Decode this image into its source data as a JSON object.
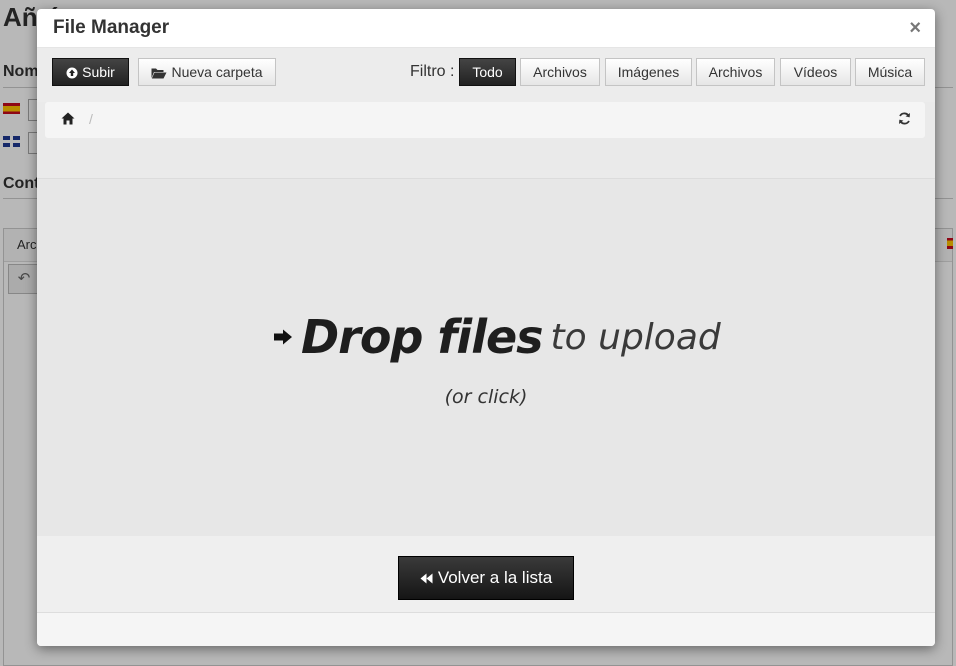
{
  "background": {
    "title": "Añ      ó",
    "label_nombre": "Nom",
    "label_contenido": "Cont",
    "panel_label": "Arc"
  },
  "modal": {
    "title": "File Manager",
    "close_symbol": "×"
  },
  "toolbar": {
    "upload_label": "Subir",
    "new_folder_label": "Nueva carpeta",
    "filter_label": "Filtro :",
    "filters": [
      "Todo",
      "Archivos",
      "Imágenes",
      "Archivos",
      "Vídeos",
      "Música"
    ],
    "active_filter": "Todo"
  },
  "breadcrumb": {
    "separator": "/"
  },
  "dropzone": {
    "strong_text": "Drop files",
    "light_text": "to upload",
    "sub_text": "(or click)"
  },
  "actions": {
    "back_label": "Volver a la lista"
  },
  "colors": {
    "active_button": "#222222",
    "overlay": "#000000"
  }
}
